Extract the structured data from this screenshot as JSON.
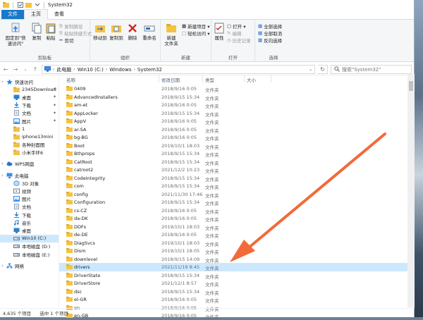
{
  "window": {
    "title": "System32"
  },
  "menu": {
    "file": "文件",
    "home": "主页",
    "view": "查看"
  },
  "ribbon": {
    "clipboard": {
      "pin": "固定到\"快\n速访问\"",
      "copy": "复制",
      "paste": "粘贴",
      "copy_path": "复制路径",
      "paste_shortcut": "粘贴快捷方式",
      "cut": "剪切",
      "label": "剪贴板"
    },
    "organize": {
      "move_to": "移动到",
      "copy_to": "复制到",
      "delete": "删除",
      "rename": "重命名",
      "label": "组织"
    },
    "new": {
      "new_folder": "新建\n文件夹",
      "new_item": "新建项目 ▾",
      "easy_access": "轻松访问 ▾",
      "label": "新建"
    },
    "open": {
      "properties": "属性",
      "open": "打开 ▾",
      "edit": "编辑",
      "history": "历史记录",
      "label": "打开"
    },
    "select": {
      "select_all": "全部选择",
      "select_none": "全部取消",
      "invert": "反向选择",
      "label": "选择"
    }
  },
  "address": {
    "crumbs": [
      "此电脑",
      "Win10 (C:)",
      "Windows",
      "System32"
    ],
    "search_placeholder": "搜索\"System32\""
  },
  "columns": {
    "name": "名称",
    "date": "修改日期",
    "type": "类型",
    "size": "大小"
  },
  "nav": [
    {
      "label": "快速访问",
      "icon": "star-icon",
      "color": "#1e88e5",
      "indent": 0,
      "pinned": false
    },
    {
      "label": "2345Download",
      "icon": "folder-icon",
      "color": "#f0c04a",
      "indent": 1,
      "pinned": true
    },
    {
      "label": "桌面",
      "icon": "desktop-icon",
      "color": "#2d7fd1",
      "indent": 1,
      "pinned": true
    },
    {
      "label": "下载",
      "icon": "download-icon",
      "color": "#2d7fd1",
      "indent": 1,
      "pinned": true
    },
    {
      "label": "文档",
      "icon": "document-icon",
      "color": "#8a9bb0",
      "indent": 1,
      "pinned": true
    },
    {
      "label": "图片",
      "icon": "picture-icon",
      "color": "#3a8ee6",
      "indent": 1,
      "pinned": true
    },
    {
      "label": "1",
      "icon": "folder-icon",
      "color": "#f0c04a",
      "indent": 1,
      "pinned": false
    },
    {
      "label": "iphone13mini",
      "icon": "folder-icon",
      "color": "#f0c04a",
      "indent": 1,
      "pinned": false
    },
    {
      "label": "各种封面图",
      "icon": "folder-icon",
      "color": "#f0c04a",
      "indent": 1,
      "pinned": false
    },
    {
      "label": "小米手环6",
      "icon": "folder-icon",
      "color": "#f0c04a",
      "indent": 1,
      "pinned": false
    },
    {
      "label": "",
      "icon": "",
      "color": "",
      "indent": 0,
      "pinned": false,
      "gap": true
    },
    {
      "label": "WPS网盘",
      "icon": "cloud-icon",
      "color": "#2a6fd6",
      "indent": 0,
      "pinned": false
    },
    {
      "label": "",
      "icon": "",
      "color": "",
      "indent": 0,
      "pinned": false,
      "gap": true
    },
    {
      "label": "此电脑",
      "icon": "computer-icon",
      "color": "#3a8ee6",
      "indent": 0,
      "pinned": false
    },
    {
      "label": "3D 对象",
      "icon": "cube-icon",
      "color": "#5aa0e0",
      "indent": 1,
      "pinned": false
    },
    {
      "label": "视频",
      "icon": "video-icon",
      "color": "#6b7c8f",
      "indent": 1,
      "pinned": false
    },
    {
      "label": "图片",
      "icon": "picture-icon",
      "color": "#3a8ee6",
      "indent": 1,
      "pinned": false
    },
    {
      "label": "文档",
      "icon": "document-icon",
      "color": "#8a9bb0",
      "indent": 1,
      "pinned": false
    },
    {
      "label": "下载",
      "icon": "download-icon",
      "color": "#2d7fd1",
      "indent": 1,
      "pinned": false
    },
    {
      "label": "音乐",
      "icon": "music-icon",
      "color": "#2d7fd1",
      "indent": 1,
      "pinned": false
    },
    {
      "label": "桌面",
      "icon": "desktop-icon",
      "color": "#2d7fd1",
      "indent": 1,
      "pinned": false
    },
    {
      "label": "Win10 (C:)",
      "icon": "drive-icon",
      "color": "#6b7c8f",
      "indent": 1,
      "pinned": false,
      "selected": true
    },
    {
      "label": "本地磁盘 (D:)",
      "icon": "drive-icon",
      "color": "#6b7c8f",
      "indent": 1,
      "pinned": false
    },
    {
      "label": "本地磁盘 (E:)",
      "icon": "drive-icon",
      "color": "#6b7c8f",
      "indent": 1,
      "pinned": false
    },
    {
      "label": "",
      "icon": "",
      "color": "",
      "indent": 0,
      "pinned": false,
      "gap": true
    },
    {
      "label": "网络",
      "icon": "network-icon",
      "color": "#3a8ee6",
      "indent": 0,
      "pinned": false
    }
  ],
  "files": [
    {
      "name": "0409",
      "date": "2018/9/16 0:05",
      "type": "文件夹"
    },
    {
      "name": "AdvancedInstallers",
      "date": "2018/9/15 15:34",
      "type": "文件夹"
    },
    {
      "name": "am-et",
      "date": "2018/9/16 0:05",
      "type": "文件夹"
    },
    {
      "name": "AppLocker",
      "date": "2018/9/15 15:34",
      "type": "文件夹"
    },
    {
      "name": "AppV",
      "date": "2018/9/16 0:05",
      "type": "文件夹"
    },
    {
      "name": "ar-SA",
      "date": "2018/9/16 0:05",
      "type": "文件夹"
    },
    {
      "name": "bg-BG",
      "date": "2018/9/16 0:05",
      "type": "文件夹"
    },
    {
      "name": "Boot",
      "date": "2019/10/1 18:03",
      "type": "文件夹"
    },
    {
      "name": "Bthprops",
      "date": "2018/9/15 15:34",
      "type": "文件夹"
    },
    {
      "name": "CatRoot",
      "date": "2018/9/15 15:34",
      "type": "文件夹"
    },
    {
      "name": "catroot2",
      "date": "2021/12/2 10:23",
      "type": "文件夹"
    },
    {
      "name": "CodeIntegrity",
      "date": "2018/9/15 15:34",
      "type": "文件夹"
    },
    {
      "name": "com",
      "date": "2018/9/15 15:34",
      "type": "文件夹"
    },
    {
      "name": "config",
      "date": "2021/11/30 17:46",
      "type": "文件夹"
    },
    {
      "name": "Configuration",
      "date": "2018/9/15 15:34",
      "type": "文件夹"
    },
    {
      "name": "cs-CZ",
      "date": "2018/9/16 0:05",
      "type": "文件夹"
    },
    {
      "name": "da-DK",
      "date": "2018/9/16 0:05",
      "type": "文件夹"
    },
    {
      "name": "DDFs",
      "date": "2019/10/1 18:03",
      "type": "文件夹"
    },
    {
      "name": "de-DE",
      "date": "2018/9/16 0:05",
      "type": "文件夹"
    },
    {
      "name": "DiagSvcs",
      "date": "2019/10/1 18:03",
      "type": "文件夹"
    },
    {
      "name": "Dism",
      "date": "2019/10/1 18:05",
      "type": "文件夹"
    },
    {
      "name": "downlevel",
      "date": "2018/9/15 14:09",
      "type": "文件夹"
    },
    {
      "name": "drivers",
      "date": "2021/11/19 8:45",
      "type": "文件夹",
      "selected": true
    },
    {
      "name": "DriverState",
      "date": "2018/9/15 15:34",
      "type": "文件夹"
    },
    {
      "name": "DriverStore",
      "date": "2021/12/1 8:57",
      "type": "文件夹"
    },
    {
      "name": "dsc",
      "date": "2018/9/15 15:34",
      "type": "文件夹"
    },
    {
      "name": "el-GR",
      "date": "2018/9/16 0:05",
      "type": "文件夹"
    },
    {
      "name": "en",
      "date": "2018/9/16 0:05",
      "type": "文件夹"
    },
    {
      "name": "en-GB",
      "date": "2018/9/16 0:05",
      "type": "文件夹"
    }
  ],
  "status": {
    "count": "4,635 个项目",
    "selected": "选中 1 个项目"
  },
  "colors": {
    "accent": "#1979ca",
    "folder": "#f5c342",
    "selection": "#cce8ff",
    "arrow": "#f26a3a"
  }
}
